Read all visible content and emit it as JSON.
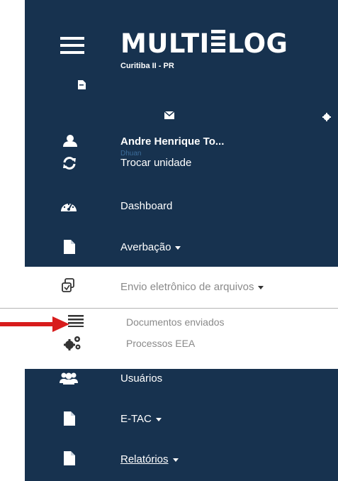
{
  "app": {
    "logo_text_left": "MULTI",
    "logo_text_right": "LOG",
    "unit_label": "Curitiba II - PR"
  },
  "user": {
    "name": "Andre Henrique To...",
    "sub": "Dhuan"
  },
  "menu": {
    "trocar": "Trocar unidade",
    "dashboard": "Dashboard",
    "averbacao": "Averbação",
    "envio": "Envio eletrônico de arquivos",
    "documentos": "Documentos enviados",
    "processos": "Processos EEA",
    "usuarios": "Usuários",
    "etac": "E-TAC",
    "relatorios": "Relatórios"
  },
  "icons": {
    "hamburger": "hamburger-icon",
    "file": "file-icon",
    "mail": "envelope-icon",
    "gear": "gear-icon",
    "user": "user-icon",
    "refresh": "refresh-icon",
    "dashboard": "dashboard-icon",
    "copy": "copy-icon",
    "list": "list-icon",
    "cogs": "cogs-icon",
    "users": "users-icon",
    "arrow": "red-arrow-icon"
  },
  "colors": {
    "sidebar_bg": "#17324f",
    "active_bg": "#ffffff",
    "muted_text": "#8a8a8a",
    "arrow": "#d81c1c"
  }
}
